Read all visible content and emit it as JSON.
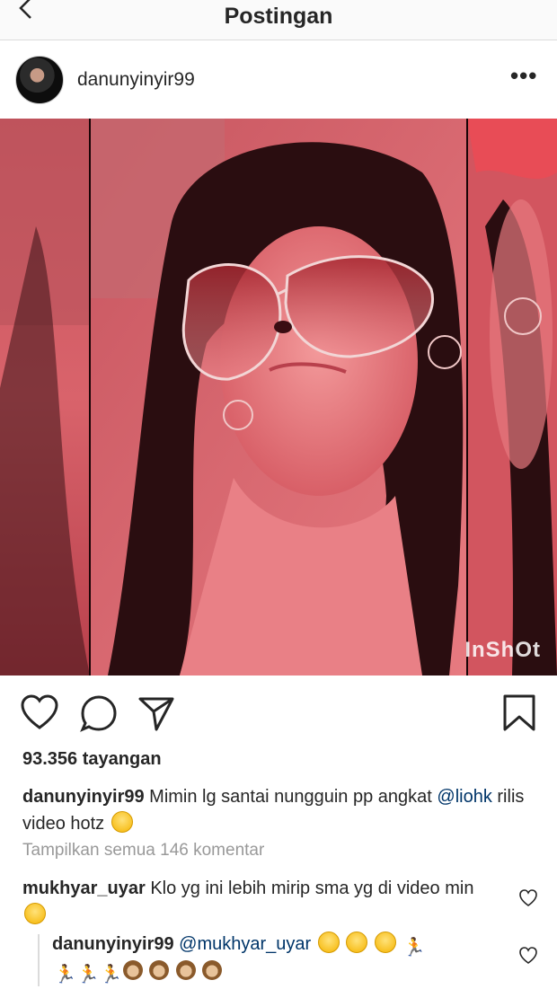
{
  "topbar": {
    "title": "Postingan"
  },
  "post": {
    "username": "danunyinyir99",
    "more_label": "•••",
    "watermark": "InShOt",
    "views": "93.356 tayangan",
    "caption": {
      "user": "danunyinyir99",
      "text1": "Mimin lg santai nungguin pp angkat",
      "mention": "@liohk",
      "text2": "rilis video hotz"
    },
    "view_all": "Tampilkan semua 146 komentar",
    "comments": [
      {
        "user": "mukhyar_uyar",
        "text": "Klo yg ini lebih mirip sma yg di video min"
      }
    ],
    "reply": {
      "user": "danunyinyir99",
      "mention": "@mukhyar_uyar"
    }
  },
  "icons": [
    "back-chevron-icon",
    "more-icon",
    "heart-icon",
    "comment-icon",
    "share-icon",
    "bookmark-icon",
    "grinning-squint-emoji",
    "running-man-emoji",
    "see-no-evil-monkey-emoji"
  ],
  "colors": {
    "mention": "#003569",
    "secondary_text": "#999999",
    "divider": "#dbdbdb"
  }
}
